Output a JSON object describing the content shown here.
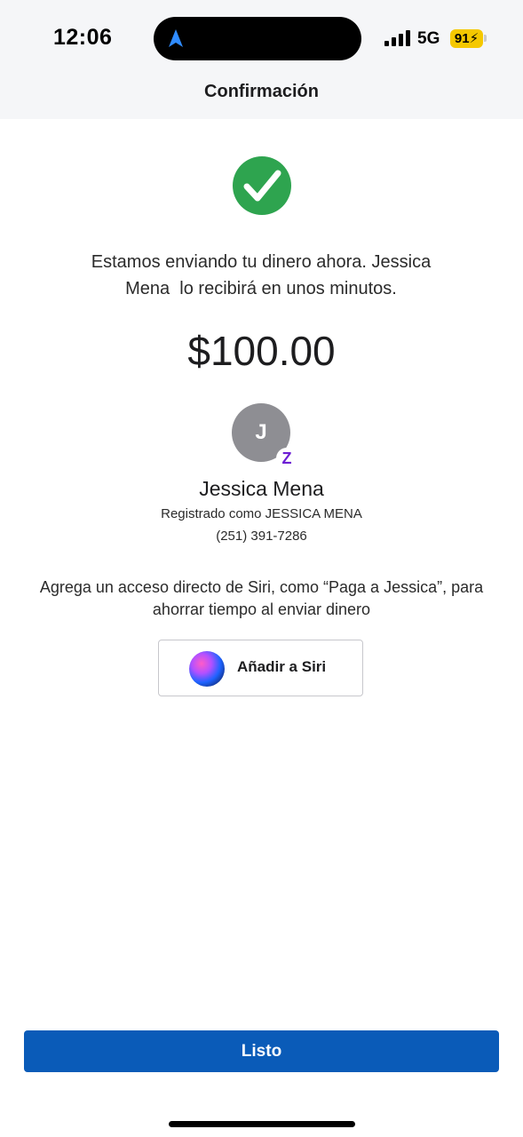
{
  "status_bar": {
    "time": "12:06",
    "network": "5G",
    "battery": "91"
  },
  "header": {
    "title": "Confirmación"
  },
  "confirmation": {
    "message_line1": "Estamos enviando tu dinero ahora. Jessica",
    "message_line2": "Mena  lo recibirá en unos minutos.",
    "amount": "$100.00"
  },
  "recipient": {
    "initial": "J",
    "name": "Jessica Mena",
    "registered": "Registrado como JESSICA MENA",
    "phone": "(251) 391-7286",
    "badge": "Z"
  },
  "siri": {
    "prompt_line1": "Agrega un acceso directo de Siri, como “Paga a Jessica”, para",
    "prompt_line2": "ahorrar tiempo al enviar dinero",
    "button_label": "Añadir a Siri"
  },
  "footer": {
    "done_label": "Listo"
  },
  "colors": {
    "primary_button": "#0a5bb8",
    "success": "#2ea44f",
    "zelle": "#6d1ed4",
    "battery": "#f5c800"
  }
}
